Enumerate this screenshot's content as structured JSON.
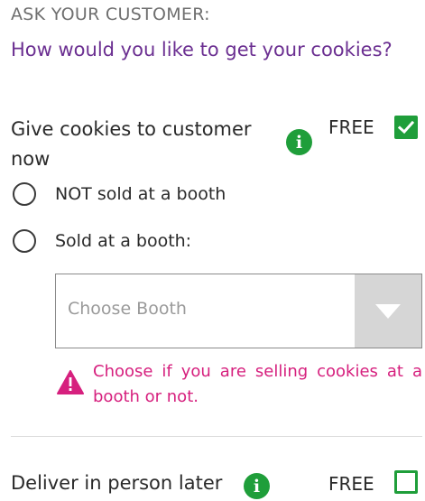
{
  "header": {
    "ask_label": "ASK YOUR CUSTOMER:",
    "question": "How would you like to get your cookies?"
  },
  "option_now": {
    "title": "Give cookies to customer now",
    "info_glyph": "i",
    "price": "FREE",
    "checked": true,
    "radios": [
      {
        "label": "NOT sold at a booth",
        "selected": false
      },
      {
        "label": "Sold at a booth:",
        "selected": false
      }
    ],
    "booth_select": {
      "placeholder": "Choose Booth",
      "selected_value": ""
    },
    "warning": {
      "icon": "warning-triangle-icon",
      "text": "Choose if you are selling cookies at a booth or not."
    }
  },
  "option_later": {
    "title": "Deliver in person later",
    "info_glyph": "i",
    "price": "FREE",
    "checked": false
  },
  "colors": {
    "question": "#6b2f91",
    "accent_green": "#1f9e3a",
    "warning": "#d6207e",
    "muted_label": "#6f6f6f"
  }
}
